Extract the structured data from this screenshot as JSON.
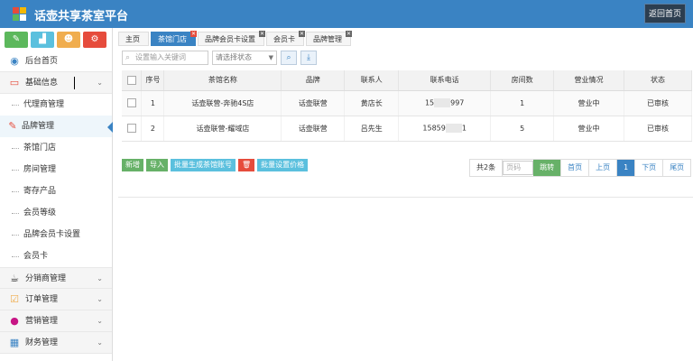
{
  "header": {
    "app_title": "话壶共享茶室平台",
    "home_button": "返回首页",
    "logo_colors": [
      "#e64c3c",
      "#f5b800",
      "#5cb85c",
      "#ffffff"
    ]
  },
  "sidebar": {
    "quick_buttons": [
      {
        "icon": "pencil-icon",
        "glyph": "✎",
        "color": "#5cb85c"
      },
      {
        "icon": "bar-chart-icon",
        "glyph": "▟",
        "color": "#5bc0de"
      },
      {
        "icon": "users-icon",
        "glyph": "☻",
        "color": "#f0ad4e"
      },
      {
        "icon": "gear-icon",
        "glyph": "⚙",
        "color": "#e64c3c"
      }
    ],
    "home_label": "后台首页",
    "basic_info_label": "基础信息",
    "agent_mgmt_label": "代理商管理",
    "brand_mgmt_label": "品牌管理",
    "sub_items": [
      "茶馆门店",
      "房间管理",
      "寄存产品",
      "会员等级",
      "品牌会员卡设置",
      "会员卡"
    ],
    "groups": [
      "分销商管理",
      "订单管理",
      "营销管理",
      "财务管理"
    ]
  },
  "tabs": [
    {
      "label": "主页",
      "closable": false,
      "active": false
    },
    {
      "label": "茶馆门店",
      "closable": true,
      "active": true
    },
    {
      "label": "品牌会员卡设置",
      "closable": true,
      "active": false
    },
    {
      "label": "会员卡",
      "closable": true,
      "active": false
    },
    {
      "label": "品牌管理",
      "closable": true,
      "active": false
    }
  ],
  "toolbar": {
    "search_placeholder": "设置输入关键词",
    "status_select": "请选择状态"
  },
  "table": {
    "columns": [
      "序号",
      "茶馆名称",
      "品牌",
      "联系人",
      "联系电话",
      "房间数",
      "营业情况",
      "状态"
    ],
    "rows": [
      {
        "no": "1",
        "name": "话壶联营-奔驰4S店",
        "brand": "话壶联营",
        "contact": "黄店长",
        "phone_start": "15",
        "phone_end": "997",
        "rooms": "1",
        "business": "营业中",
        "status": "已审核"
      },
      {
        "no": "2",
        "name": "话壶联营-耀域店",
        "brand": "话壶联营",
        "contact": "吕先生",
        "phone_start": "15859",
        "phone_end": "1",
        "rooms": "5",
        "business": "营业中",
        "status": "已审核"
      }
    ]
  },
  "actions": [
    {
      "label": "新增",
      "color": "#67b168"
    },
    {
      "label": "导入",
      "color": "#67b168"
    },
    {
      "label": "批量生成茶馆账号",
      "color": "#5bc0de"
    },
    {
      "label": "🗑",
      "color": "#e64c3c"
    },
    {
      "label": "批量设置价格",
      "color": "#5bc0de"
    }
  ],
  "pager": {
    "total": "共2条",
    "input_placeholder": "页码",
    "go": "跳转",
    "first": "首页",
    "prev": "上页",
    "current": "1",
    "next": "下页",
    "last": "尾页"
  }
}
